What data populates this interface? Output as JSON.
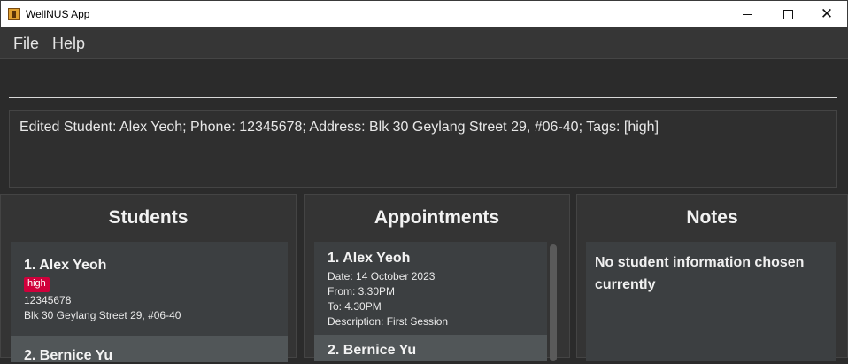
{
  "window": {
    "title": "WellNUS App"
  },
  "menu": {
    "file": "File",
    "help": "Help"
  },
  "command": {
    "value": ""
  },
  "result": {
    "text": "Edited Student: Alex Yeoh; Phone: 12345678; Address: Blk 30 Geylang Street 29, #06-40; Tags: [high]"
  },
  "students": {
    "title": "Students",
    "items": [
      {
        "name": "1.  Alex Yeoh",
        "tag": "high",
        "phone": "12345678",
        "address": "Blk 30 Geylang Street 29, #06-40"
      },
      {
        "name": "2.  Bernice Yu"
      }
    ]
  },
  "appointments": {
    "title": "Appointments",
    "items": [
      {
        "name": "1.  Alex Yeoh",
        "date": "Date: 14 October 2023",
        "from": "From: 3.30PM",
        "to": "To: 4.30PM",
        "description": "Description: First Session"
      },
      {
        "name": "2.  Bernice Yu"
      }
    ]
  },
  "notes": {
    "title": "Notes",
    "text": "No student information chosen currently"
  },
  "colors": {
    "background": "#2b2b2b",
    "card": "#3c3f41",
    "card_selected": "#515658",
    "tag": "#d0003b"
  },
  "icons": {
    "app": "app-icon",
    "minimize": "minimize-icon",
    "maximize": "maximize-icon",
    "close": "close-icon"
  }
}
